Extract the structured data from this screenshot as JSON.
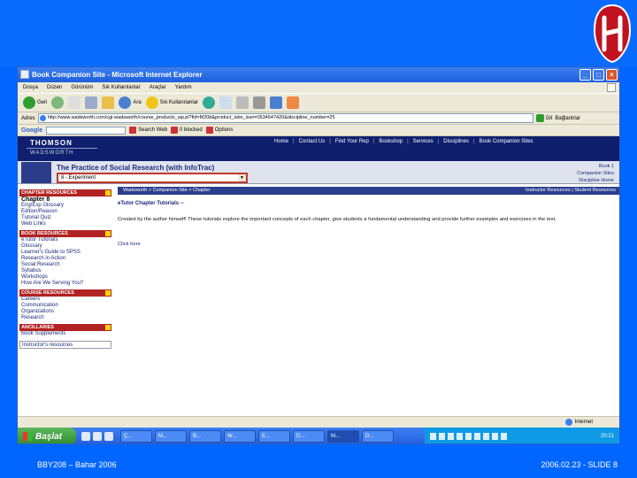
{
  "slide": {
    "footer_left": "BBY208 – Bahar 2006",
    "footer_right": "2006.02.23 - SLIDE 8"
  },
  "window": {
    "title": "Book Companion Site - Microsoft Internet Explorer",
    "menu": [
      "Dosya",
      "Düzen",
      "Görünüm",
      "Sık Kullanılanlar",
      "Araçlar",
      "Yardım"
    ],
    "toolbar": {
      "back_label": "Geri",
      "search_label": "Ara",
      "favorites_label": "Sık Kullanılanlar"
    },
    "address_label": "Adres",
    "address_value": "http://www.wadsworth.com/cgi-wadsworth/course_products_wp.pl?fid=M20b&product_isbn_issn=0534547420&discipline_number=25",
    "go_label": "Git",
    "links_label": "Bağlantılar"
  },
  "googlebar": {
    "logo": "Google",
    "search_web": "Search Web",
    "blocked": "0 blocked",
    "options": "Options"
  },
  "site": {
    "brand": "THOMSON",
    "subbrand": "WADSWORTH",
    "nav": [
      "Home",
      "Contact Us",
      "Find Your Rep",
      "Bookshop",
      "Services",
      "Disciplines",
      "Book Companion Sites"
    ],
    "book_title": "The Practice of Social Research (with InfoTrac)",
    "chapter_select": "8 - Experiment",
    "right_links": [
      "Book 1",
      "Companion Sites",
      "Discipline Home"
    ]
  },
  "sidebar": {
    "chapter_resources": "CHAPTER RESOURCES",
    "chapter_items": [
      "Chapter 8",
      "Eng/Esp Glossary",
      "Edition/Reason",
      "Tutorial Quiz",
      "Web Links"
    ],
    "book_resources": "BOOK RESOURCES",
    "book_items": [
      "eTutor Tutorials",
      "Glossary",
      "Learner's Guide to SPSS",
      "Research in Action",
      "Social Research",
      "Syllabus",
      "Workshops",
      "How Are We Serving You?"
    ],
    "course_resources": "COURSE RESOURCES",
    "course_items": [
      "Careers",
      "Communication",
      "Organizations",
      "Research"
    ],
    "ancillaries": "ANCILLARIES",
    "ancillary_items": [
      "Book Supplements"
    ],
    "extra": "Instructor's resources"
  },
  "content": {
    "crumb": "Wadsworth > Companion Site > Chapter",
    "crumb_right": "Instructor Resources | Student Resources",
    "title": "eTutor Chapter Tutorials --",
    "body": "Created by the author himself! These tutorials explore the important concepts of each chapter, give students a fundamental understanding and provide further examples and exercises in the text.",
    "link": "Click here"
  },
  "status": {
    "left": "",
    "zone": "Internet"
  },
  "taskbar": {
    "start": "Başlat",
    "tasks": [
      "Ç...",
      "M...",
      "B...",
      "W...",
      "E...",
      "D...",
      "M...",
      "D..."
    ],
    "clock": "20:21"
  }
}
